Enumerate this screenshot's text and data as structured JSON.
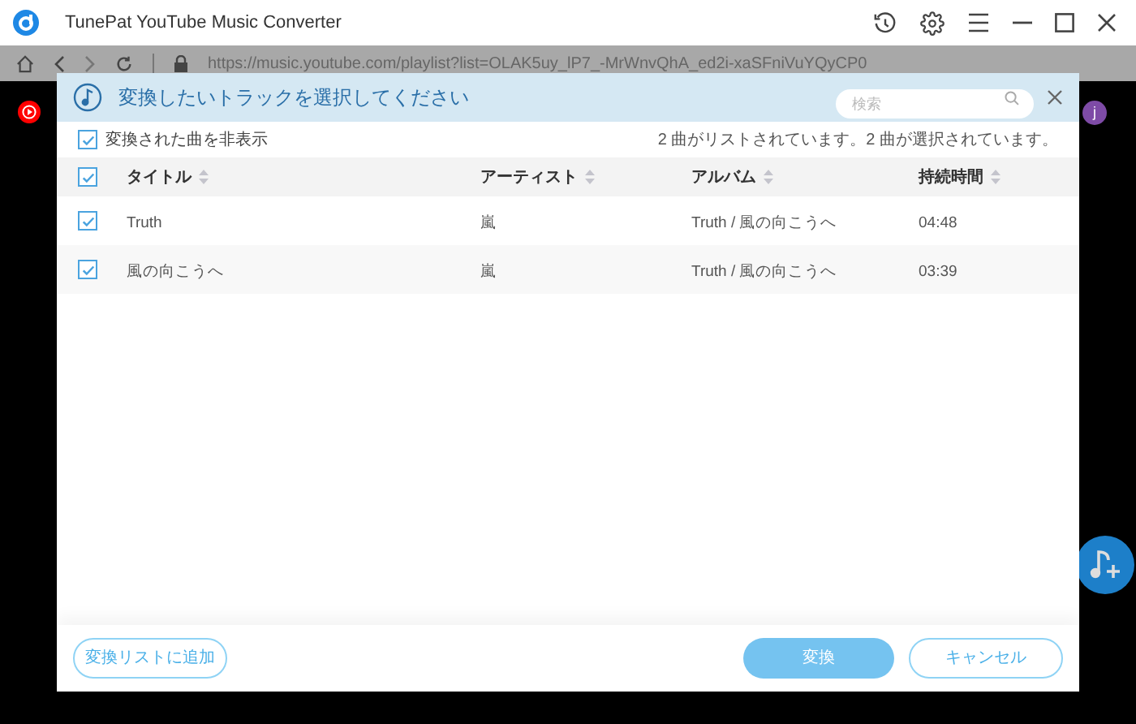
{
  "window": {
    "title": "TunePat YouTube Music Converter"
  },
  "address_bar": {
    "url": "https://music.youtube.com/playlist?list=OLAK5uy_lP7_-MrWnvQhA_ed2i-xaSFniVuYQyCP0"
  },
  "background": {
    "avatar": "j"
  },
  "dialog": {
    "title": "変換したいトラックを選択してください",
    "search": {
      "placeholder": "検索"
    },
    "hide_converted": {
      "label": "変換された曲を非表示",
      "checked": true
    },
    "status": "2 曲がリストされています。2 曲が選択されています。",
    "select_all": {
      "checked": true
    },
    "columns": [
      "タイトル",
      "アーティスト",
      "アルバム",
      "持続時間"
    ],
    "rows": [
      {
        "checked": true,
        "cells": [
          "Truth",
          "嵐",
          "Truth / 風の向こうへ",
          "04:48"
        ]
      },
      {
        "checked": true,
        "cells": [
          "風の向こうへ",
          "嵐",
          "Truth / 風の向こうへ",
          "03:39"
        ]
      }
    ],
    "buttons": [
      {
        "label": "変換リストに追加",
        "kind": "outline"
      },
      {
        "label": "変換",
        "kind": "primary"
      },
      {
        "label": "キャンセル",
        "kind": "outline"
      }
    ]
  }
}
